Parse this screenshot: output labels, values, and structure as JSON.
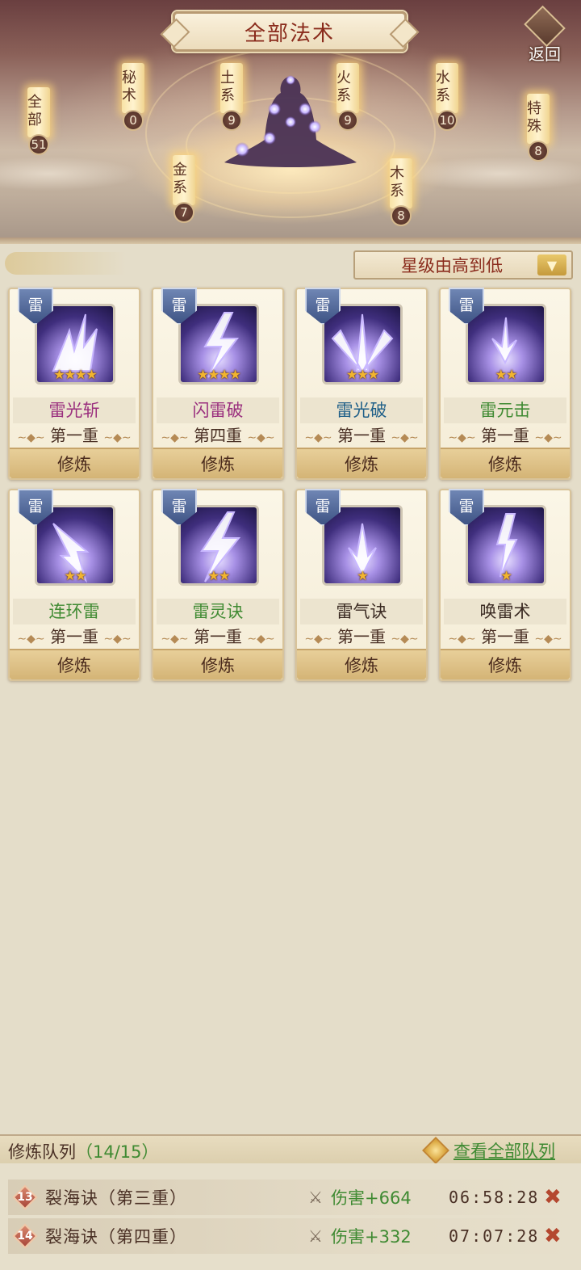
{
  "header": {
    "title": "全部法术",
    "back_label": "返回"
  },
  "categories": [
    {
      "label": "全部",
      "count": "51"
    },
    {
      "label": "秘术",
      "count": "0"
    },
    {
      "label": "土系",
      "count": "9"
    },
    {
      "label": "火系",
      "count": "9"
    },
    {
      "label": "水系",
      "count": "10"
    },
    {
      "label": "特殊",
      "count": "8"
    },
    {
      "label": "金系",
      "count": "7"
    },
    {
      "label": "木系",
      "count": "8"
    }
  ],
  "sort": {
    "selected": "星级由高到低"
  },
  "spells": [
    {
      "element": "雷",
      "name": "雷光斩",
      "name_color": "#9a2f7e",
      "stars": 4,
      "star_text": "★★★★",
      "level": "第一重",
      "button": "修炼"
    },
    {
      "element": "雷",
      "name": "闪雷破",
      "name_color": "#9a2f7e",
      "stars": 4,
      "star_text": "★★★★",
      "level": "第四重",
      "button": "修炼"
    },
    {
      "element": "雷",
      "name": "雷光破",
      "name_color": "#1f5f88",
      "stars": 3,
      "star_text": "★★★",
      "level": "第一重",
      "button": "修炼"
    },
    {
      "element": "雷",
      "name": "雷元击",
      "name_color": "#3f8a32",
      "stars": 2,
      "star_text": "★★",
      "level": "第一重",
      "button": "修炼"
    },
    {
      "element": "雷",
      "name": "连环雷",
      "name_color": "#3f8a32",
      "stars": 2,
      "star_text": "★★",
      "level": "第一重",
      "button": "修炼"
    },
    {
      "element": "雷",
      "name": "雷灵诀",
      "name_color": "#3f8a32",
      "stars": 2,
      "star_text": "★★",
      "level": "第一重",
      "button": "修炼"
    },
    {
      "element": "雷",
      "name": "雷气诀",
      "name_color": "#3a2a22",
      "stars": 1,
      "star_text": "★",
      "level": "第一重",
      "button": "修炼"
    },
    {
      "element": "雷",
      "name": "唤雷术",
      "name_color": "#3a2a22",
      "stars": 1,
      "star_text": "★",
      "level": "第一重",
      "button": "修炼"
    }
  ],
  "queue": {
    "title": "修炼队列",
    "count": "（14/15）",
    "view_all": "查看全部队列",
    "items": [
      {
        "index": "13",
        "name": "裂海诀（第三重）",
        "effect": "伤害+664",
        "time": "06:58:28"
      },
      {
        "index": "14",
        "name": "裂海诀（第四重）",
        "effect": "伤害+332",
        "time": "07:07:28"
      }
    ]
  }
}
